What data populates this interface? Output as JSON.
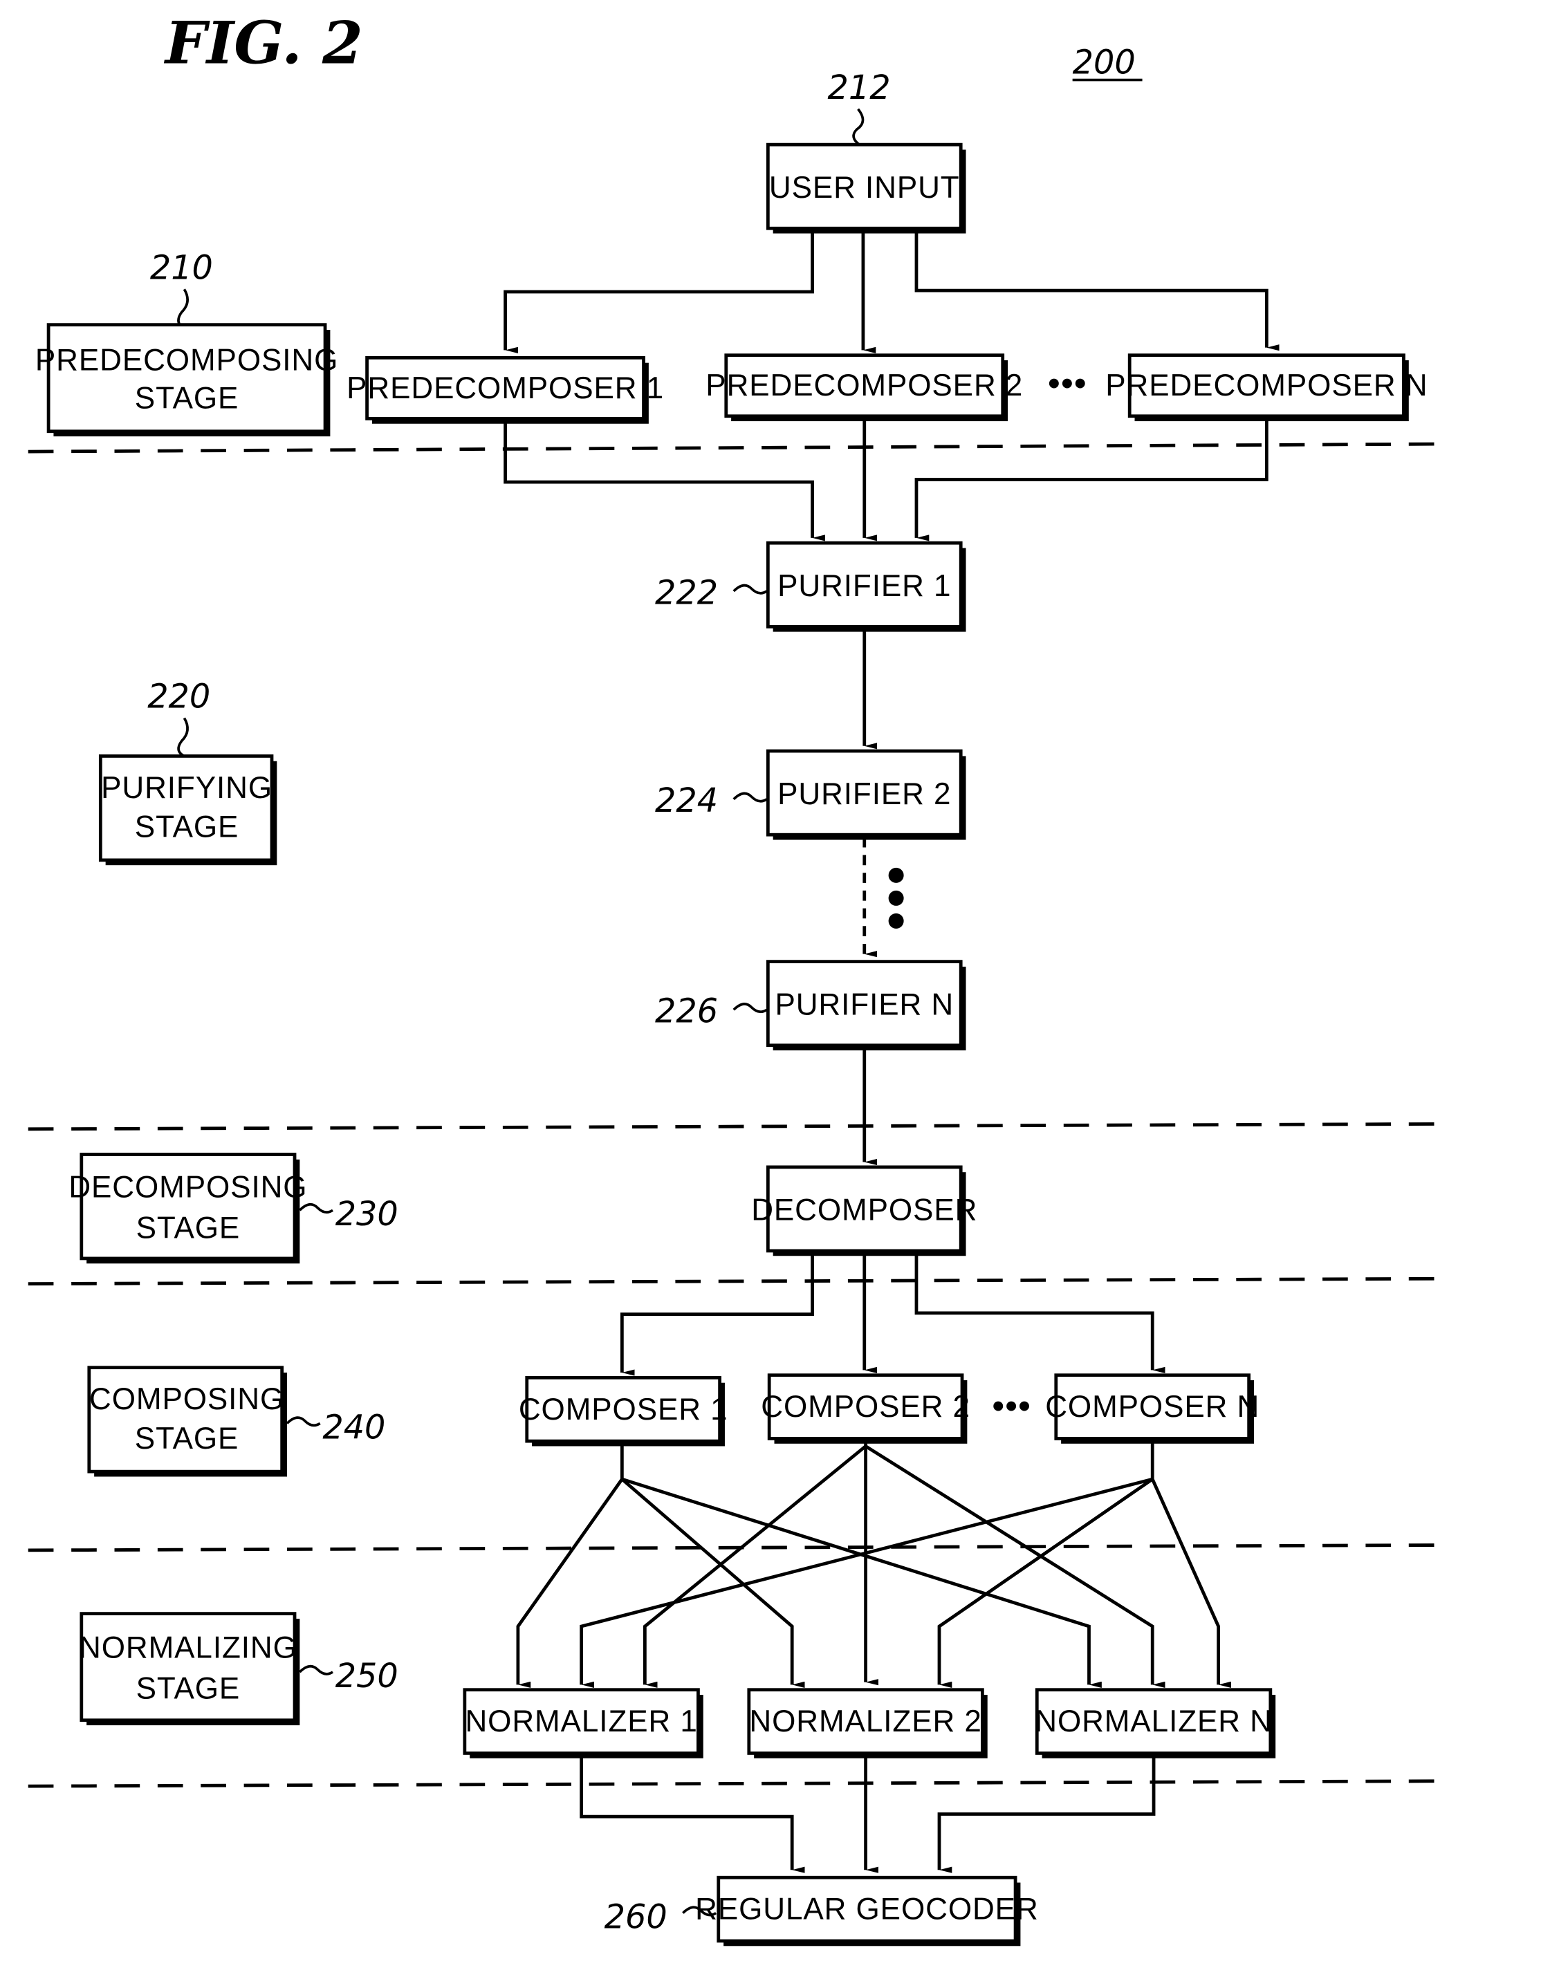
{
  "figure": {
    "title": "FIG. 2",
    "ref_number": "200"
  },
  "stages": [
    {
      "ref": "210",
      "label_lines": [
        "PREDECOMPOSING",
        "STAGE"
      ]
    },
    {
      "ref": "220",
      "label_lines": [
        "PURIFYING",
        "STAGE"
      ]
    },
    {
      "ref": "230",
      "label_lines": [
        "DECOMPOSING",
        "STAGE"
      ]
    },
    {
      "ref": "240",
      "label_lines": [
        "COMPOSING",
        "STAGE"
      ]
    },
    {
      "ref": "250",
      "label_lines": [
        "NORMALIZING",
        "STAGE"
      ]
    }
  ],
  "nodes": {
    "user_input": {
      "ref": "212",
      "label": "USER INPUT"
    },
    "predecomposers": [
      "PREDECOMPOSER 1",
      "PREDECOMPOSER 2",
      "PREDECOMPOSER N"
    ],
    "purifiers": [
      {
        "ref": "222",
        "label": "PURIFIER 1"
      },
      {
        "ref": "224",
        "label": "PURIFIER 2"
      },
      {
        "ref": "226",
        "label": "PURIFIER N"
      }
    ],
    "decomposer": {
      "label": "DECOMPOSER"
    },
    "composers": [
      "COMPOSER 1",
      "COMPOSER 2",
      "COMPOSER N"
    ],
    "normalizers": [
      "NORMALIZER 1",
      "NORMALIZER 2",
      "NORMALIZER N"
    ],
    "geocoder": {
      "ref": "260",
      "label": "REGULAR GEOCODER"
    }
  },
  "ellipsis": "•••"
}
